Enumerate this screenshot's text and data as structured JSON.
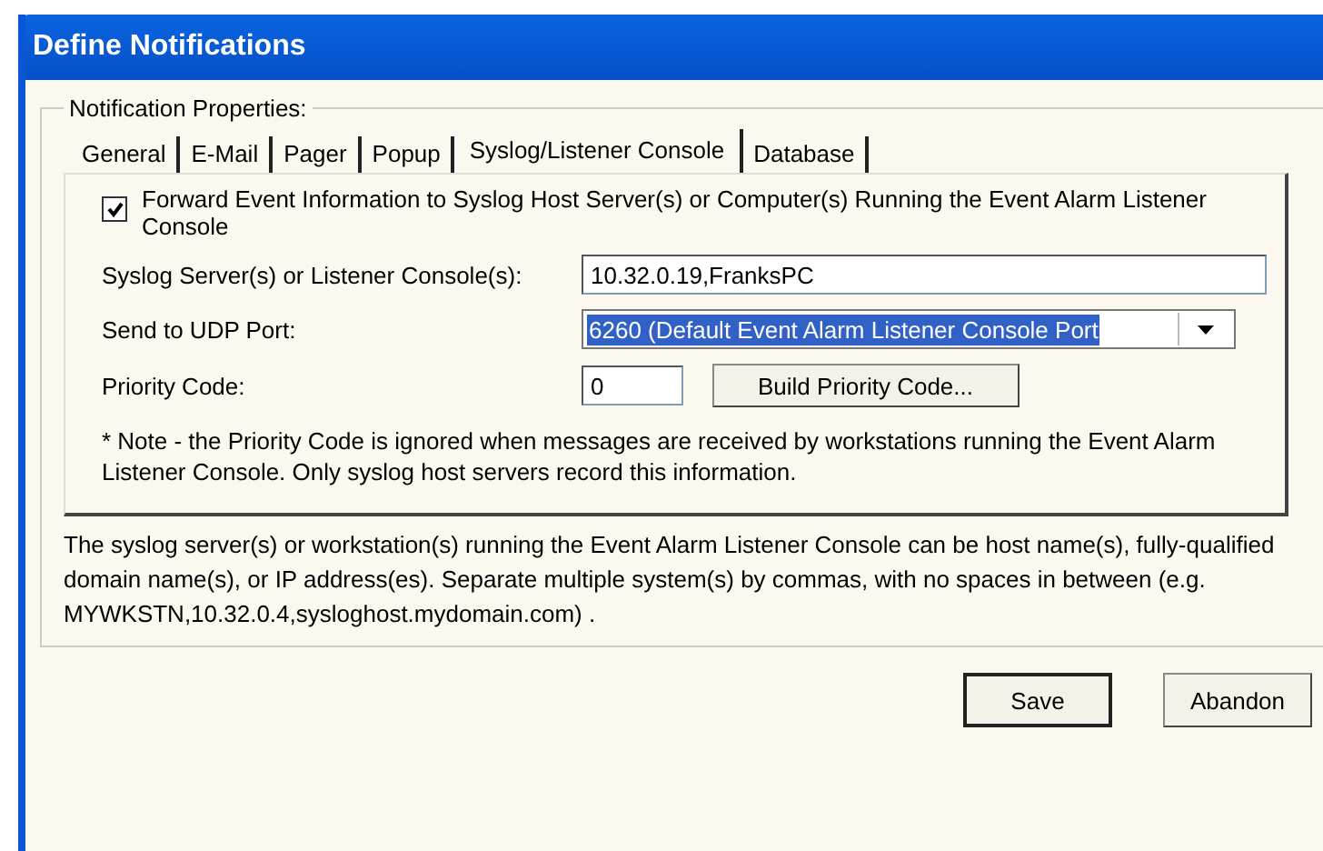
{
  "window": {
    "title": "Define Notifications"
  },
  "group": {
    "label": "Notification Properties:"
  },
  "tabs": [
    {
      "label": "General",
      "selected": false
    },
    {
      "label": "E-Mail",
      "selected": false
    },
    {
      "label": "Pager",
      "selected": false
    },
    {
      "label": "Popup",
      "selected": false
    },
    {
      "label": "Syslog/Listener Console",
      "selected": true
    },
    {
      "label": "Database",
      "selected": false
    }
  ],
  "forward": {
    "label": "Forward Event Information to Syslog Host Server(s) or Computer(s) Running the Event Alarm Listener Console",
    "checked": true
  },
  "servers": {
    "label": "Syslog Server(s) or Listener Console(s):",
    "value": "10.32.0.19,FranksPC"
  },
  "port": {
    "label": "Send to UDP Port:",
    "value": "6260 (Default Event Alarm Listener Console Port"
  },
  "priority": {
    "label": "Priority Code:",
    "value": "0",
    "button": "Build Priority Code..."
  },
  "note": "* Note - the Priority Code is ignored when messages are received by workstations running the Event Alarm Listener Console.  Only syslog host servers record this information.",
  "help": "The syslog server(s) or workstation(s) running the Event Alarm Listener Console can be host name(s), fully-qualified domain name(s), or IP address(es).  Separate multiple system(s) by commas, with no spaces in between (e.g. MYWKSTN,10.32.0.4,sysloghost.mydomain.com) .",
  "buttons": [
    "Save",
    "Abandon"
  ]
}
